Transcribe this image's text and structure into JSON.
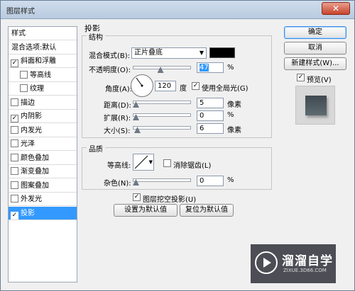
{
  "window": {
    "title": "图层样式",
    "close_label": "✕"
  },
  "left_panel": {
    "items": [
      {
        "label": "样式",
        "type": "header"
      },
      {
        "label": "混合选项:默认",
        "type": "header"
      },
      {
        "label": "斜面和浮雕",
        "checked": true,
        "indent": false
      },
      {
        "label": "等高线",
        "checked": false,
        "indent": true
      },
      {
        "label": "纹理",
        "checked": false,
        "indent": true
      },
      {
        "label": "描边",
        "checked": false,
        "indent": false
      },
      {
        "label": "内阴影",
        "checked": true,
        "indent": false
      },
      {
        "label": "内发光",
        "checked": false,
        "indent": false
      },
      {
        "label": "光泽",
        "checked": false,
        "indent": false
      },
      {
        "label": "颜色叠加",
        "checked": false,
        "indent": false
      },
      {
        "label": "渐变叠加",
        "checked": false,
        "indent": false
      },
      {
        "label": "图案叠加",
        "checked": false,
        "indent": false
      },
      {
        "label": "外发光",
        "checked": false,
        "indent": false
      },
      {
        "label": "投影",
        "checked": true,
        "indent": false,
        "selected": true
      }
    ]
  },
  "drop_shadow": {
    "section_title": "投影",
    "structure": {
      "title": "结构",
      "blend_mode_label": "混合模式(B):",
      "blend_mode_value": "正片叠底",
      "blend_color": "#000000",
      "opacity_label": "不透明度(O):",
      "opacity_value": "47",
      "opacity_fraction": 0.47,
      "percent": "%",
      "angle_label": "角度(A):",
      "angle_value": "120",
      "degree": "度",
      "global_light_label": "使用全局光(G)",
      "global_light_checked": true,
      "distance_label": "距离(D):",
      "distance_value": "5",
      "spread_label": "扩展(R):",
      "spread_value": "0",
      "size_label": "大小(S):",
      "size_value": "6",
      "px": "像素"
    },
    "quality": {
      "title": "品质",
      "contour_label": "等高线:",
      "antialias_label": "消除锯齿(L)",
      "antialias_checked": false,
      "noise_label": "杂色(N):",
      "noise_value": "0",
      "percent": "%"
    },
    "knockout_label": "图层挖空投影(U)",
    "knockout_checked": true,
    "make_default_label": "设置为默认值",
    "reset_default_label": "复位为默认值"
  },
  "right_panel": {
    "ok_label": "确定",
    "cancel_label": "取消",
    "new_style_label": "新建样式(W)...",
    "preview_label": "预览(V)",
    "preview_checked": true
  },
  "watermark": {
    "name": "溜溜自学",
    "url": "ZIXUE.3D66.COM"
  }
}
